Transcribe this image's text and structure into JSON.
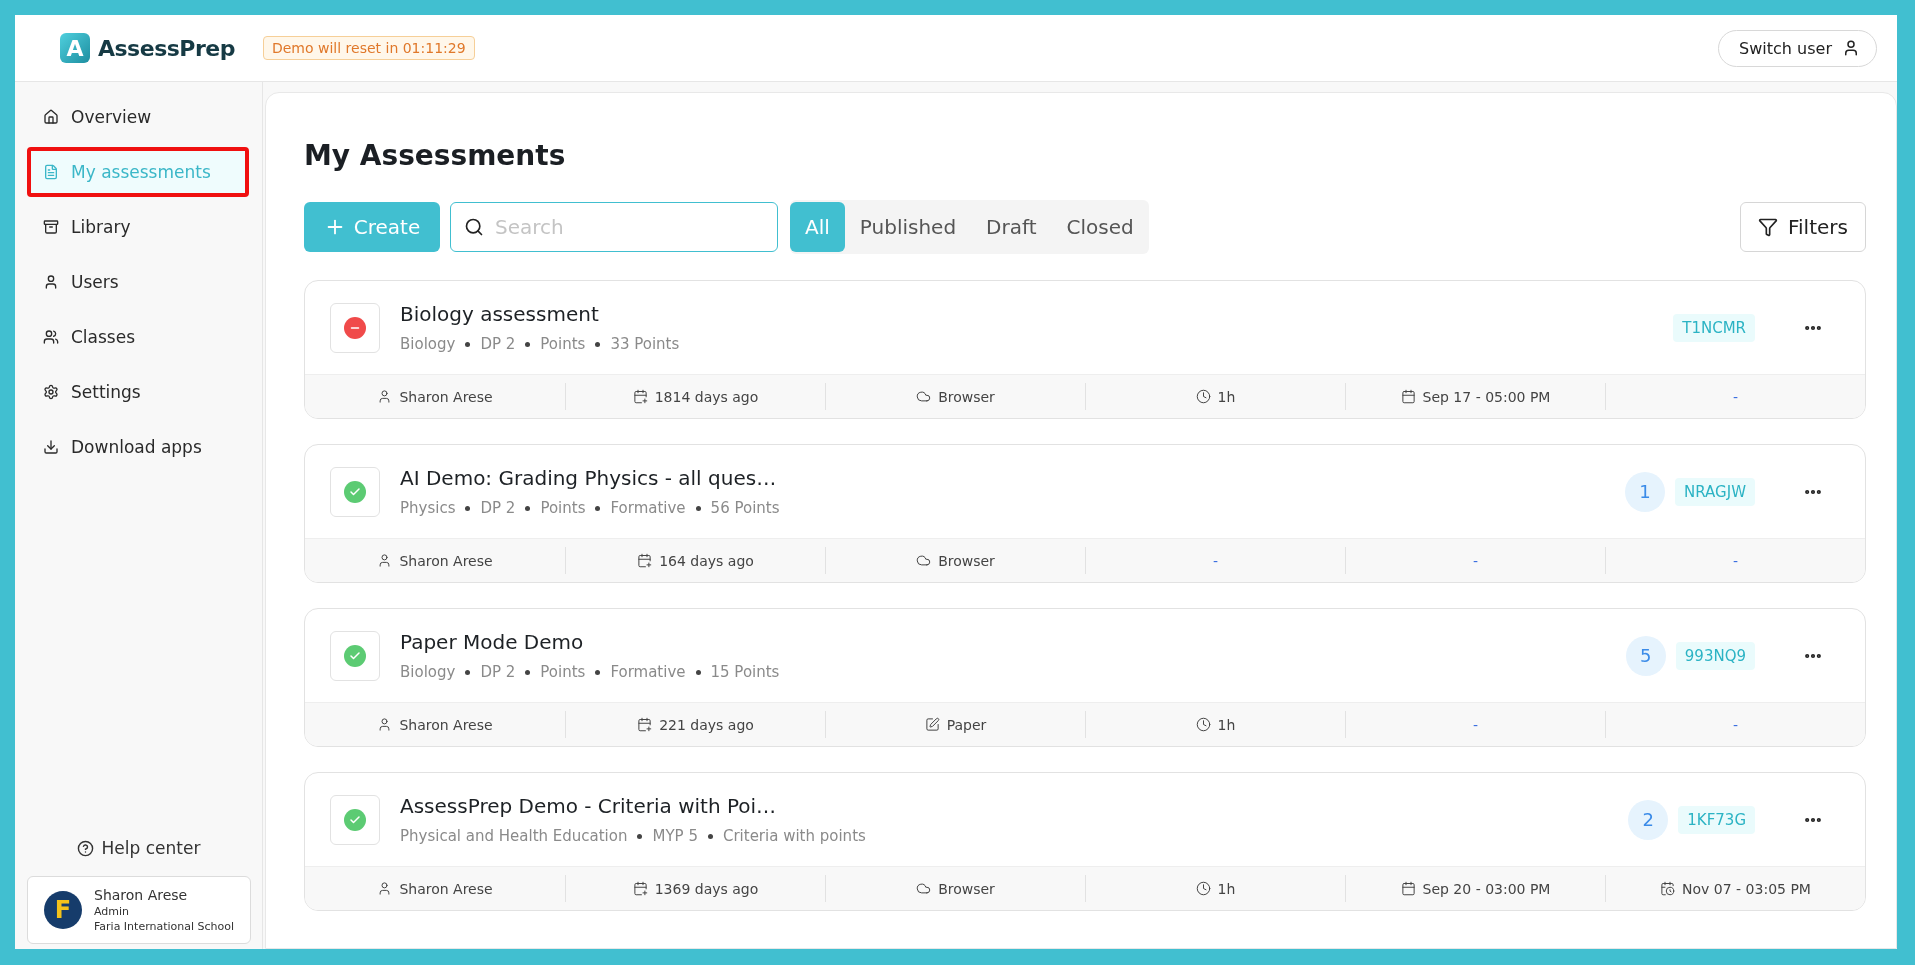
{
  "header": {
    "logo": {
      "mark": "A",
      "name": "AssessPrep"
    },
    "demo_notice": "Demo will reset in 01:11:29",
    "switch_user": "Switch user"
  },
  "sidebar": {
    "items": [
      {
        "label": "Overview",
        "selected": false,
        "highlighted": false
      },
      {
        "label": "My assessments",
        "selected": true,
        "highlighted": true
      },
      {
        "label": "Library",
        "selected": false,
        "highlighted": false
      },
      {
        "label": "Users",
        "selected": false,
        "highlighted": false
      },
      {
        "label": "Classes",
        "selected": false,
        "highlighted": false
      },
      {
        "label": "Settings",
        "selected": false,
        "highlighted": false
      },
      {
        "label": "Download apps",
        "selected": false,
        "highlighted": false
      }
    ],
    "help": "Help center",
    "profile": {
      "initial": "F",
      "name": "Sharon Arese",
      "role": "Admin",
      "school": "Faria International School"
    }
  },
  "page": {
    "title": "My Assessments",
    "create": "Create",
    "search": {
      "placeholder": "Search"
    },
    "tabs": [
      {
        "label": "All",
        "selected": true
      },
      {
        "label": "Published",
        "selected": false
      },
      {
        "label": "Draft",
        "selected": false
      },
      {
        "label": "Closed",
        "selected": false
      }
    ],
    "filters": "Filters"
  },
  "assessments": [
    {
      "kind": "closed",
      "title": "Biology assessment",
      "meta": [
        "Biology",
        "DP 2",
        "Points",
        "33 Points"
      ],
      "code": "T1NCMR",
      "footer": [
        {
          "kind": "person",
          "text": "Sharon Arese"
        },
        {
          "kind": "created",
          "text": "1814 days ago"
        },
        {
          "kind": "browser",
          "text": "Browser"
        },
        {
          "kind": "duration",
          "text": "1h"
        },
        {
          "kind": "start",
          "text": "Sep 17 - 05:00 PM"
        },
        {
          "kind": "none",
          "text": "-"
        }
      ]
    },
    {
      "kind": "published",
      "title": "AI Demo: Grading Physics - all ques…",
      "meta": [
        "Physics",
        "DP 2",
        "Points",
        "Formative",
        "56 Points"
      ],
      "count": "1",
      "code": "NRAGJW",
      "footer": [
        {
          "kind": "person",
          "text": "Sharon Arese"
        },
        {
          "kind": "created",
          "text": "164 days ago"
        },
        {
          "kind": "browser",
          "text": "Browser"
        },
        {
          "kind": "none",
          "text": "-"
        },
        {
          "kind": "none",
          "text": "-"
        },
        {
          "kind": "none",
          "text": "-"
        }
      ]
    },
    {
      "kind": "published",
      "title": "Paper Mode Demo",
      "meta": [
        "Biology",
        "DP 2",
        "Points",
        "Formative",
        "15 Points"
      ],
      "count": "5",
      "code": "993NQ9",
      "footer": [
        {
          "kind": "person",
          "text": "Sharon Arese"
        },
        {
          "kind": "created",
          "text": "221 days ago"
        },
        {
          "kind": "paper",
          "text": "Paper"
        },
        {
          "kind": "duration",
          "text": "1h"
        },
        {
          "kind": "none",
          "text": "-"
        },
        {
          "kind": "none",
          "text": "-"
        }
      ]
    },
    {
      "kind": "published",
      "title": "AssessPrep Demo - Criteria with Poi…",
      "meta": [
        "Physical and Health Education",
        "MYP 5",
        "Criteria with points"
      ],
      "count": "2",
      "code": "1KF73G",
      "footer": [
        {
          "kind": "person",
          "text": "Sharon Arese"
        },
        {
          "kind": "created",
          "text": "1369 days ago"
        },
        {
          "kind": "browser",
          "text": "Browser"
        },
        {
          "kind": "duration",
          "text": "1h"
        },
        {
          "kind": "start",
          "text": "Sep 20 - 03:00 PM"
        },
        {
          "kind": "end",
          "text": "Nov 07 - 03:05 PM"
        }
      ]
    }
  ]
}
